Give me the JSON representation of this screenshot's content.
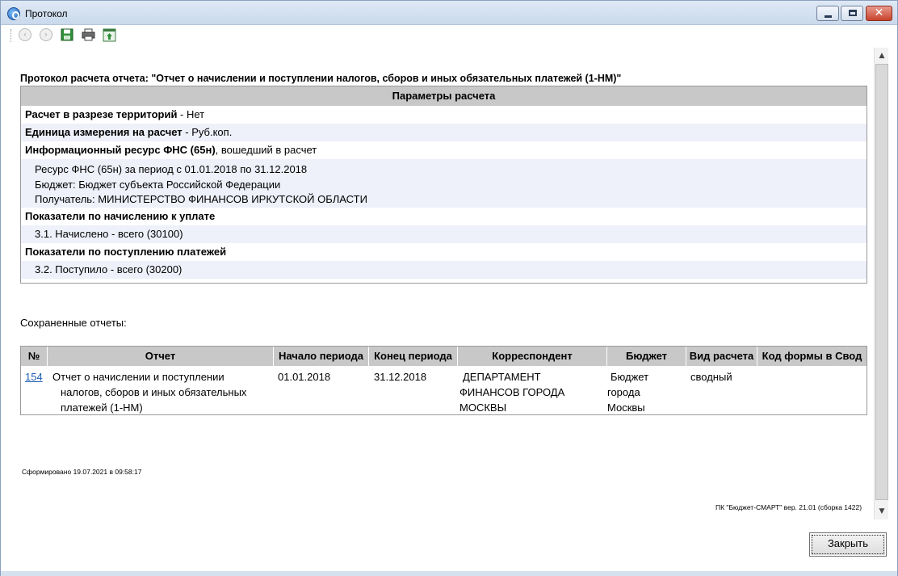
{
  "window": {
    "title": "Протокол"
  },
  "toolbar": {
    "buttons": [
      "back-icon",
      "forward-icon",
      "save-icon",
      "print-icon",
      "export-icon"
    ]
  },
  "report": {
    "title": "Протокол расчета отчета: \"Отчет о начислении и поступлении налогов, сборов и иных обязательных платежей (1-НМ)\""
  },
  "params": {
    "header": "Параметры расчета",
    "territory_label": "Расчет в разрезе территорий",
    "territory_value": " - Нет",
    "unit_label": "Единица измерения на расчет",
    "unit_value": " - Руб.коп.",
    "resource_label": "Информационный ресурс ФНС (65н)",
    "resource_value": ", вошедший в расчет",
    "resource_lines": [
      "Ресурс ФНС (65н) за период с 01.01.2018 по 31.12.2018",
      "Бюджет: Бюджет субъекта Российской Федерации",
      "Получатель: МИНИСТЕРСТВО ФИНАНСОВ ИРКУТСКОЙ ОБЛАСТИ"
    ],
    "accrual_label": "Показатели по начислению к уплате",
    "accrual_item": "3.1. Начислено - всего (30100)",
    "receipt_label": "Показатели по поступлению платежей",
    "receipt_item": "3.2. Поступило - всего (30200)"
  },
  "saved": {
    "label": "Сохраненные отчеты:",
    "columns": [
      "№",
      "Отчет",
      "Начало периода",
      "Конец периода",
      "Корреспондент",
      "Бюджет",
      "Вид расчета",
      "Код формы в Свод"
    ],
    "rows": [
      {
        "num": "154",
        "report_lines": [
          "Отчет о начислении и поступлении",
          "налогов, сборов и иных обязательных",
          "платежей (1-НМ)"
        ],
        "start": "01.01.2018",
        "end": "31.12.2018",
        "correspondent_lines": [
          "ДЕПАРТАМЕНТ",
          "ФИНАНСОВ ГОРОДА",
          "МОСКВЫ"
        ],
        "budget_lines": [
          "Бюджет",
          "города",
          "Москвы"
        ],
        "calc_type": "сводный",
        "form_code": ""
      }
    ]
  },
  "footer": {
    "generated": "Сформировано 19.07.2021 в 09:58:17",
    "version": "ПК \"Бюджет-СМАРТ\" вер. 21.01 (сборка 1422)",
    "close_label": "Закрыть"
  }
}
